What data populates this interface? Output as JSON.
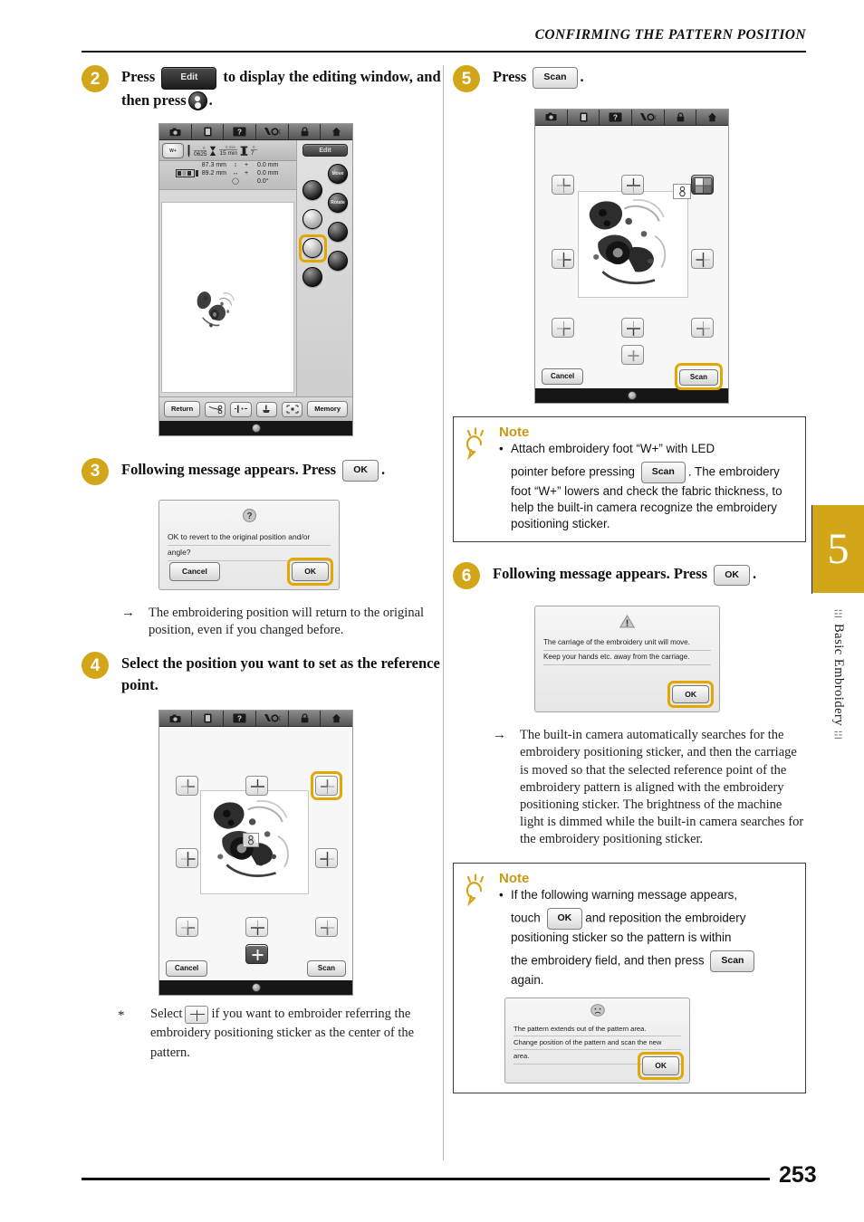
{
  "header": {
    "title": "CONFIRMING THE PATTERN POSITION"
  },
  "page": {
    "number": "253"
  },
  "chapter": {
    "number": "5",
    "label": "Basic Embroidery"
  },
  "steps": {
    "s2": {
      "num": "2",
      "text_a": "Press",
      "chip_edit": "Edit",
      "text_b": "to display the editing window, and then press",
      "text_c": "."
    },
    "s3": {
      "num": "3",
      "text_a": "Following message appears. Press",
      "chip_ok": "OK",
      "text_b": ".",
      "arrow": "The embroidering position will return to the original position, even if you changed before."
    },
    "s4": {
      "num": "4",
      "text": "Select the position you want to set as the reference point.",
      "footnote_star": "*",
      "footnote_a": "Select",
      "footnote_b": "if you want to embroider referring the embroidery positioning sticker as the center of the pattern."
    },
    "s5": {
      "num": "5",
      "text_a": "Press",
      "chip_scan": "Scan",
      "text_b": "."
    },
    "s6": {
      "num": "6",
      "text_a": "Following message appears. Press",
      "chip_ok": "OK",
      "text_b": ".",
      "arrow": "The built-in camera automatically searches for the embroidery positioning sticker, and then the carriage is moved so that the selected reference point of the embroidery pattern is aligned with the embroidery positioning sticker. The brightness of the machine light is dimmed while the built-in camera searches for the embroidery positioning sticker."
    }
  },
  "edit_screen": {
    "tabs": [
      "camera-icon",
      "page-icon",
      "help-icon",
      "needle-icon",
      "lock-icon",
      "home-icon"
    ],
    "foot_badge": "W+",
    "stat_stitch_top": "0",
    "stat_stitch": "0625",
    "stat_time_top": "0 min",
    "stat_time": "15 min",
    "stat_spool_top": "0",
    "stat_spool": "7",
    "dim_height": "87.3 mm",
    "dim_width": "89.2 mm",
    "dim_offset_v": "0.0 mm",
    "dim_offset_h": "0.0 mm",
    "dim_angle": "0.0°",
    "edit_label": "Edit",
    "side_buttons": [
      "Move",
      "Rotate",
      "size-icon",
      "color-icon",
      "border-icon",
      "sticker-icon",
      "pen-icon"
    ],
    "bottom": {
      "return_label": "Return",
      "memory_label": "Memory",
      "icons": [
        "thread-cut-icon",
        "needle-mode-icon",
        "presser-foot-icon",
        "trial-frame-icon"
      ]
    }
  },
  "dialog_revert": {
    "icon": "question-icon",
    "line1": "OK to revert to the original position and/or",
    "line2": "angle?",
    "cancel_label": "Cancel",
    "ok_label": "OK"
  },
  "dialog_carriage": {
    "icon": "warning-icon",
    "line1": "The carriage of the embroidery unit will move.",
    "line2": "Keep your hands etc. away from the carriage.",
    "ok_label": "OK"
  },
  "dialog_extends": {
    "icon": "sad-face-icon",
    "line1": "The pattern extends out of the pattern area.",
    "line2": "Change position of the pattern and scan the new",
    "line3": "area.",
    "ok_label": "OK"
  },
  "reference_screen": {
    "cancel_label": "Cancel",
    "scan_label": "Scan",
    "sticker_marker": "sticker-icon",
    "positions": [
      "top-left",
      "top-center",
      "top-right",
      "middle-left",
      "middle-right",
      "bottom-left",
      "bottom-center",
      "bottom-right",
      "center-plus"
    ]
  },
  "note1": {
    "title": "Note",
    "bullet": "•",
    "part_a": "Attach embroidery foot “W+” with LED",
    "part_b": "pointer before pressing",
    "chip_scan": "Scan",
    "part_c": ". The embroidery foot “W+” lowers and check the fabric thickness, to help the built-in camera recognize the embroidery positioning sticker."
  },
  "note2": {
    "title": "Note",
    "bullet": "•",
    "part_a": "If the following warning message appears,",
    "part_b": "touch",
    "chip_ok": "OK",
    "part_c": "and reposition the embroidery positioning sticker so the pattern is within",
    "part_d": "the embroidery field, and then press",
    "chip_scan": "Scan",
    "part_e": "again."
  },
  "colors": {
    "accent_gold": "#D2A618",
    "highlight_gold": "#E0A800",
    "text": "#1a1a1a"
  }
}
